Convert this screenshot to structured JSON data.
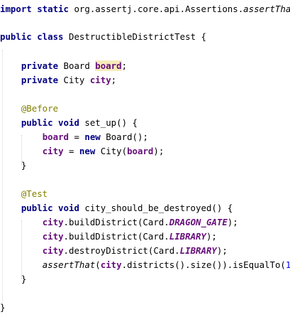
{
  "lines": [
    [
      {
        "t": "import static",
        "c": "kw"
      },
      {
        "t": " org.assertj.core.api.Assertions.",
        "c": "tx"
      },
      {
        "t": "assertThat",
        "c": "it"
      },
      {
        "t": ";",
        "c": "tx"
      }
    ],
    [],
    [
      {
        "t": "public class",
        "c": "kw"
      },
      {
        "t": " DestructibleDistrictTest {",
        "c": "tx"
      }
    ],
    [],
    [
      {
        "t": "    ",
        "c": "tx"
      },
      {
        "t": "private",
        "c": "kw"
      },
      {
        "t": " Board ",
        "c": "tx"
      },
      {
        "t": "board",
        "c": "fld hl"
      },
      {
        "t": ";",
        "c": "tx"
      }
    ],
    [
      {
        "t": "    ",
        "c": "tx"
      },
      {
        "t": "private",
        "c": "kw"
      },
      {
        "t": " City ",
        "c": "tx"
      },
      {
        "t": "city",
        "c": "fld"
      },
      {
        "t": ";",
        "c": "tx"
      }
    ],
    [],
    [
      {
        "t": "    ",
        "c": "tx"
      },
      {
        "t": "@Before",
        "c": "ann"
      }
    ],
    [
      {
        "t": "    ",
        "c": "tx"
      },
      {
        "t": "public void",
        "c": "kw"
      },
      {
        "t": " set_up() {",
        "c": "tx"
      }
    ],
    [
      {
        "t": "        ",
        "c": "tx"
      },
      {
        "t": "board",
        "c": "fld"
      },
      {
        "t": " = ",
        "c": "tx"
      },
      {
        "t": "new",
        "c": "kw"
      },
      {
        "t": " Board();",
        "c": "tx"
      }
    ],
    [
      {
        "t": "        ",
        "c": "tx"
      },
      {
        "t": "city",
        "c": "fld"
      },
      {
        "t": " = ",
        "c": "tx"
      },
      {
        "t": "new",
        "c": "kw"
      },
      {
        "t": " City(",
        "c": "tx"
      },
      {
        "t": "board",
        "c": "fld"
      },
      {
        "t": ");",
        "c": "tx"
      }
    ],
    [
      {
        "t": "    }",
        "c": "tx"
      }
    ],
    [],
    [
      {
        "t": "    ",
        "c": "tx"
      },
      {
        "t": "@Test",
        "c": "ann"
      }
    ],
    [
      {
        "t": "    ",
        "c": "tx"
      },
      {
        "t": "public void",
        "c": "kw"
      },
      {
        "t": " city_should_be_destroyed() {",
        "c": "tx"
      }
    ],
    [
      {
        "t": "        ",
        "c": "tx"
      },
      {
        "t": "city",
        "c": "fld"
      },
      {
        "t": ".buildDistrict(Card.",
        "c": "tx"
      },
      {
        "t": "DRAGON_GATE",
        "c": "sfld"
      },
      {
        "t": ");",
        "c": "tx"
      }
    ],
    [
      {
        "t": "        ",
        "c": "tx"
      },
      {
        "t": "city",
        "c": "fld"
      },
      {
        "t": ".buildDistrict(Card.",
        "c": "tx"
      },
      {
        "t": "LIBRARY",
        "c": "sfld"
      },
      {
        "t": ");",
        "c": "tx"
      }
    ],
    [
      {
        "t": "        ",
        "c": "tx"
      },
      {
        "t": "city",
        "c": "fld"
      },
      {
        "t": ".destroyDistrict(Card.",
        "c": "tx"
      },
      {
        "t": "LIBRARY",
        "c": "sfld"
      },
      {
        "t": ");",
        "c": "tx"
      }
    ],
    [
      {
        "t": "        ",
        "c": "tx"
      },
      {
        "t": "assertThat",
        "c": "it"
      },
      {
        "t": "(",
        "c": "tx"
      },
      {
        "t": "city",
        "c": "fld"
      },
      {
        "t": ".districts().size()).isEqualTo(",
        "c": "tx"
      },
      {
        "t": "1",
        "c": "num"
      },
      {
        "t": ");",
        "c": "tx"
      }
    ],
    [
      {
        "t": "    }",
        "c": "tx"
      }
    ],
    [],
    [
      {
        "t": "}",
        "c": "tx"
      }
    ]
  ]
}
